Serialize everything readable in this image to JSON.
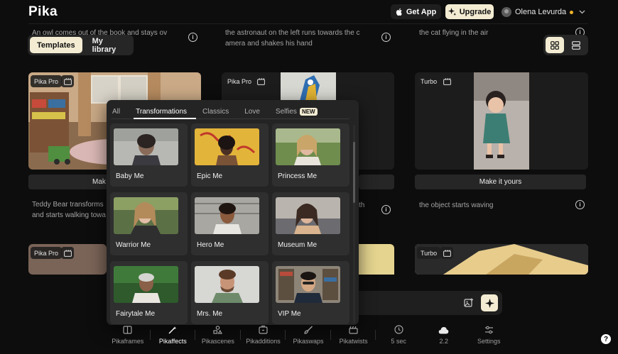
{
  "header": {
    "logo": "Pika",
    "get_app": "Get App",
    "upgrade": "Upgrade",
    "user_name": "Olena Levurda"
  },
  "mode_tabs": [
    {
      "label": "Templates",
      "active": true
    },
    {
      "label": "My library",
      "active": false
    }
  ],
  "prompts": {
    "r1c1": "An owl comes out of the book and stays ov",
    "r1c2a": "the astronaut on the left runs towards the c",
    "r1c2b": "amera and shakes his hand",
    "r1c3": "the cat flying in the air",
    "r2c1a": "Teddy Bear transforms",
    "r2c1b": "and starts walking towa",
    "r2c2": "th",
    "r2c3": "the object starts waving"
  },
  "cards": {
    "c1_tag": "Pika Pro",
    "c2_tag": "Pika Pro",
    "c3_tag": "Turbo",
    "c4_tag": "Pika Pro",
    "c6_tag": "Turbo",
    "c1_button": "Mak",
    "c3_button": "Make it yours"
  },
  "panel": {
    "tabs": [
      {
        "label": "All"
      },
      {
        "label": "Transformations"
      },
      {
        "label": "Classics"
      },
      {
        "label": "Love"
      },
      {
        "label": "Selfies"
      }
    ],
    "new_badge": "NEW",
    "tiles": [
      {
        "label": "Baby Me"
      },
      {
        "label": "Epic Me"
      },
      {
        "label": "Princess Me"
      },
      {
        "label": "Warrior Me"
      },
      {
        "label": "Hero Me"
      },
      {
        "label": "Museum Me"
      },
      {
        "label": "Fairytale Me"
      },
      {
        "label": "Mrs. Me"
      },
      {
        "label": "VIP Me"
      }
    ]
  },
  "bottom_bar": [
    {
      "label": "Pikaframes",
      "icon": "frames-icon"
    },
    {
      "label": "Pikaffects",
      "icon": "magic-wand-icon",
      "active": true
    },
    {
      "label": "Pikascenes",
      "icon": "shapes-icon"
    },
    {
      "label": "Pikadditions",
      "icon": "add-media-icon"
    },
    {
      "label": "Pikaswaps",
      "icon": "brush-icon"
    },
    {
      "label": "Pikatwists",
      "icon": "clapper-icon"
    },
    {
      "label": "5 sec",
      "icon": "clock-icon"
    },
    {
      "label": "2.2",
      "icon": "cloud-icon"
    },
    {
      "label": "Settings",
      "icon": "sliders-icon"
    }
  ],
  "help": "?",
  "colors": {
    "background": "#0d0d0d",
    "accent": "#f3ecd3",
    "card": "#1c1c1c",
    "panel": "#242424",
    "status_dot": "#f0b429"
  }
}
